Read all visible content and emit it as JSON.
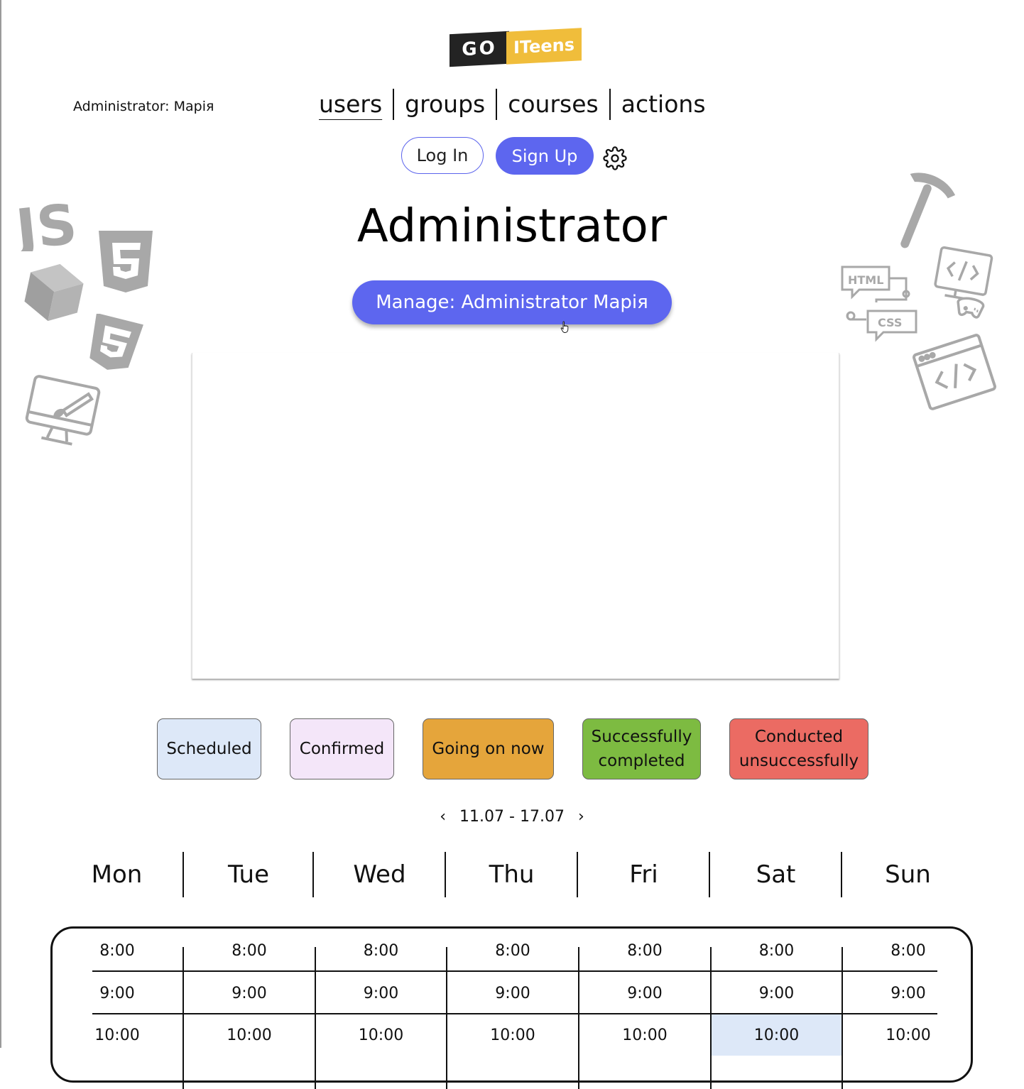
{
  "header": {
    "logo": {
      "part1": "GO",
      "part2": "ITeens",
      "dark_color": "#232323",
      "accent_color": "#f0bd3b"
    },
    "admin_label": "Administrator: Марія",
    "nav": [
      {
        "label": "users",
        "active": true
      },
      {
        "label": "groups",
        "active": false
      },
      {
        "label": "courses",
        "active": false
      },
      {
        "label": "actions",
        "active": false
      }
    ],
    "login_label": "Log In",
    "signup_label": "Sign Up",
    "settings_icon": "gear-icon"
  },
  "main": {
    "title": "Administrator",
    "manage_label": "Manage: Administrator Марія"
  },
  "legend": [
    {
      "label": "Scheduled",
      "color": "#dde8f8"
    },
    {
      "label": "Confirmed",
      "color": "#f4e6f9"
    },
    {
      "label": "Going on now",
      "color": "#e5a53b"
    },
    {
      "label": "Successfully completed",
      "color": "#7dbb41"
    },
    {
      "label": "Conducted unsuccessfully",
      "color": "#eb6b63"
    }
  ],
  "week": {
    "range": "11.07 - 17.07",
    "prev": "‹",
    "next": "›"
  },
  "days": [
    "Mon",
    "Tue",
    "Wed",
    "Thu",
    "Fri",
    "Sat",
    "Sun"
  ],
  "schedule": {
    "times": [
      "8:00",
      "9:00",
      "10:00"
    ],
    "highlight": {
      "day": "Sat",
      "time": "10:00",
      "status": "Scheduled"
    }
  },
  "decorations": [
    "js-icon",
    "html5-icon",
    "cube-icon",
    "css3-icon",
    "monitor-paint-icon",
    "pickaxe-icon",
    "html-css-icon",
    "computer-game-icon",
    "browser-code-icon"
  ],
  "accent": "#5d66ef"
}
